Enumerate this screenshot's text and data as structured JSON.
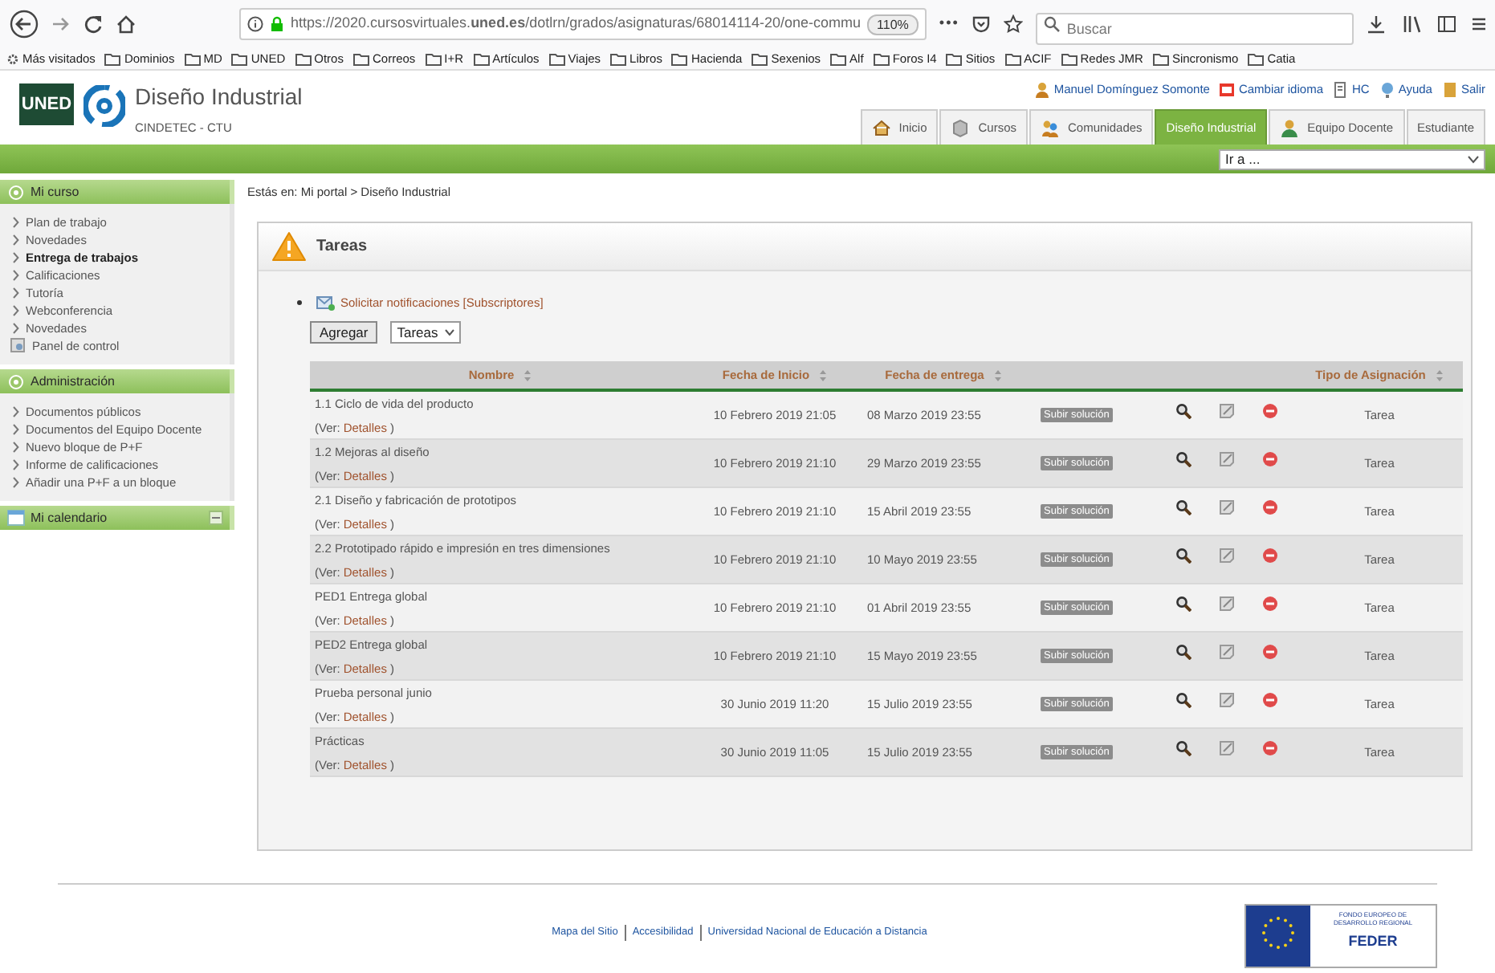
{
  "browser": {
    "url": "https://2020.cursosvirtuales.**uned.es**/dotlrn/grados/asignaturas/68014114-20/one-commu",
    "zoom": "110%",
    "more": "•••",
    "search_placeholder": "Buscar",
    "bookmarks": [
      "Más visitados",
      "Dominios",
      "MD",
      "UNED",
      "Otros",
      "Correos",
      "I+R",
      "Artículos",
      "Viajes",
      "Libros",
      "Hacienda",
      "Sexenios",
      "Alf",
      "Foros I4",
      "Sitios",
      "ACIF",
      "Redes JMR",
      "Sincronismo",
      "Catia"
    ]
  },
  "header": {
    "logo": "UNED",
    "title": "Diseño Industrial",
    "subtitle": "CINDETEC - CTU",
    "user_links": [
      "Manuel Domínguez Somonte",
      "Cambiar idioma",
      "HC",
      "Ayuda",
      "Salir"
    ],
    "tabs": [
      {
        "label": "Inicio",
        "selected": false
      },
      {
        "label": "Cursos",
        "selected": false
      },
      {
        "label": "Comunidades",
        "selected": false
      },
      {
        "label": "Diseño Industrial",
        "selected": true
      },
      {
        "label": "Equipo Docente",
        "selected": false
      },
      {
        "label": "Estudiante",
        "selected": false
      }
    ],
    "goto": "Ir a ..."
  },
  "sidebar": [
    {
      "title": "Mi curso",
      "collapse": false,
      "items": [
        {
          "label": "Plan de trabajo",
          "kind": "link",
          "current": false
        },
        {
          "label": "Novedades",
          "kind": "link",
          "current": false
        },
        {
          "label": "Entrega de trabajos",
          "kind": "link",
          "current": true
        },
        {
          "label": "Calificaciones",
          "kind": "link",
          "current": false
        },
        {
          "label": "Tutoría",
          "kind": "link",
          "current": false
        },
        {
          "label": "Webconferencia",
          "kind": "link",
          "current": false
        },
        {
          "label": "Novedades",
          "kind": "link",
          "current": false
        },
        {
          "label": "Panel de control",
          "kind": "panel",
          "current": false
        }
      ]
    },
    {
      "title": "Administración",
      "collapse": false,
      "items": [
        {
          "label": "Documentos públicos",
          "kind": "link",
          "current": false
        },
        {
          "label": "Documentos del Equipo Docente",
          "kind": "link",
          "current": false
        },
        {
          "label": "Nuevo bloque de P+F",
          "kind": "link",
          "current": false
        },
        {
          "label": "Informe de calificaciones",
          "kind": "link",
          "current": false
        },
        {
          "label": "Añadir una P+F a un bloque",
          "kind": "link",
          "current": false
        }
      ]
    },
    {
      "title": "Mi calendario",
      "collapse": true
    }
  ],
  "breadcrumb": "Estás en: Mi portal > Diseño Industrial",
  "panel": {
    "title": "Tareas",
    "notify": "Solicitar notificaciones [Subscriptores]",
    "add_button": "Agregar",
    "type_select": "Tareas",
    "columns": [
      "Nombre",
      "Fecha de Inicio",
      "Fecha de entrega",
      "Tipo de Asignación"
    ],
    "rows": [
      {
        "name": "1.1 Ciclo de vida del producto",
        "ver": "(Ver:",
        "link": "Detalles",
        "close": ")",
        "start": "10 Febrero 2019 21:05",
        "due": "08 Marzo 2019 23:55",
        "action": "Subir solución",
        "type": "Tarea"
      },
      {
        "name": "1.2 Mejoras al diseño",
        "ver": "(Ver:",
        "link": "Detalles",
        "close": ")",
        "start": "10 Febrero 2019 21:10",
        "due": "29 Marzo 2019 23:55",
        "action": "Subir solución",
        "type": "Tarea"
      },
      {
        "name": "2.1 Diseño y fabricación de prototipos",
        "ver": "(Ver:",
        "link": "Detalles",
        "close": ")",
        "start": "10 Febrero 2019 21:10",
        "due": "15 Abril 2019 23:55",
        "action": "Subir solución",
        "type": "Tarea"
      },
      {
        "name": "2.2 Prototipado rápido e impresión en tres dimensiones",
        "ver": "(Ver:",
        "link": "Detalles",
        "close": ")",
        "start": "10 Febrero 2019 21:10",
        "due": "10 Mayo 2019 23:55",
        "action": "Subir solución",
        "type": "Tarea"
      },
      {
        "name": "PED1 Entrega global",
        "ver": "(Ver:",
        "link": "Detalles",
        "close": ")",
        "start": "10 Febrero 2019 21:10",
        "due": "01 Abril 2019 23:55",
        "action": "Subir solución",
        "type": "Tarea"
      },
      {
        "name": "PED2 Entrega global",
        "ver": "(Ver:",
        "link": "Detalles",
        "close": ")",
        "start": "10 Febrero 2019 21:10",
        "due": "15 Mayo 2019 23:55",
        "action": "Subir solución",
        "type": "Tarea"
      },
      {
        "name": "Prueba personal junio",
        "ver": "(Ver:",
        "link": "Detalles",
        "close": ")",
        "start": "30 Junio 2019 11:20",
        "due": "15 Julio 2019 23:55",
        "action": "Subir solución",
        "type": "Tarea"
      },
      {
        "name": "Prácticas",
        "ver": "(Ver:",
        "link": "Detalles",
        "close": ")",
        "start": "30 Junio 2019 11:05",
        "due": "15 Julio 2019 23:55",
        "action": "Subir solución",
        "type": "Tarea"
      }
    ]
  },
  "footer": {
    "links": [
      "Mapa del Sitio",
      "Accesibilidad",
      "Universidad Nacional de Educación a Distancia"
    ],
    "feder_caption": "FONDO EUROPEO DE DESARROLLO REGIONAL",
    "feder": "FEDER"
  }
}
